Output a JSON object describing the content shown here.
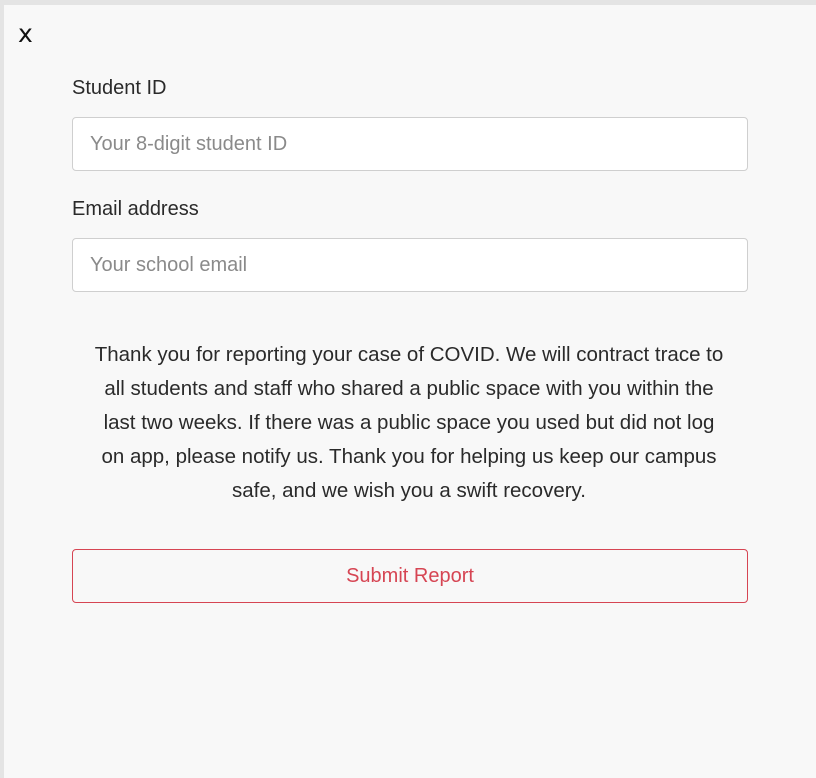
{
  "modal": {
    "close_label": "x",
    "student_id": {
      "label": "Student ID",
      "placeholder": "Your 8-digit student ID",
      "value": ""
    },
    "email": {
      "label": "Email address",
      "placeholder": "Your school email",
      "value": ""
    },
    "message": "Thank you for reporting your case of COVID. We will contract trace to all students and staff who shared a public space with you within the last two weeks. If there was a public space you used but did not log on app, please notify us. Thank you for helping us keep our campus safe, and we wish you a swift recovery.",
    "submit_label": "Submit Report"
  },
  "colors": {
    "accent": "#d64553",
    "modal_background": "#f8f8f8",
    "backdrop": "#e4e4e4"
  }
}
